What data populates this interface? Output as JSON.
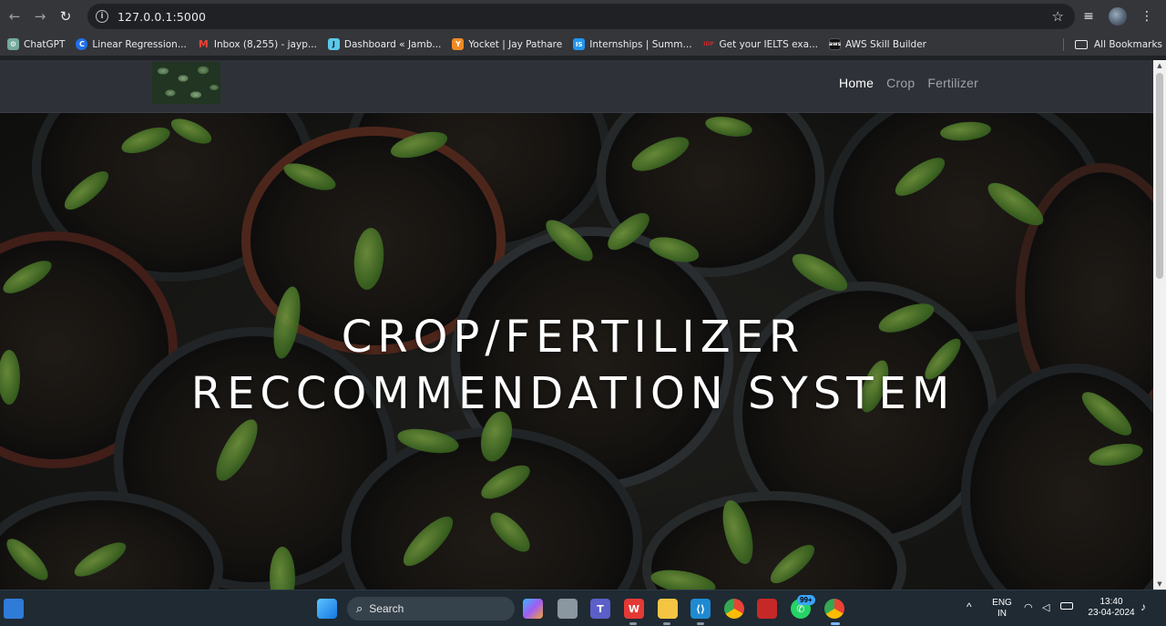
{
  "browser": {
    "url": "127.0.0.1:5000",
    "bookmarks": [
      {
        "label": "ChatGPT",
        "icon": "chatgpt-icon",
        "color": "#74aa9c",
        "glyph": "⚙"
      },
      {
        "label": "Linear Regression...",
        "icon": "coursera-icon",
        "color": "#1f6feb",
        "glyph": "C"
      },
      {
        "label": "Inbox (8,255) - jayp...",
        "icon": "gmail-icon",
        "color": "#ea4335",
        "glyph": "M"
      },
      {
        "label": "Dashboard « Jamb...",
        "icon": "jamboard-icon",
        "color": "#5cc8ea",
        "glyph": "J"
      },
      {
        "label": "Yocket | Jay Pathare",
        "icon": "yocket-icon",
        "color": "#f08a24",
        "glyph": "Y"
      },
      {
        "label": "Internships | Summ...",
        "icon": "internshala-icon",
        "color": "#2196f3",
        "glyph": "IS"
      },
      {
        "label": "Get your IELTS exa...",
        "icon": "ielts-icon",
        "color": "#c62828",
        "glyph": "·"
      },
      {
        "label": "AWS Skill Builder",
        "icon": "aws-icon",
        "color": "#111111",
        "glyph": "a"
      }
    ],
    "all_bookmarks": "All Bookmarks"
  },
  "site": {
    "nav": [
      {
        "label": "Home",
        "active": true
      },
      {
        "label": "Crop",
        "active": false
      },
      {
        "label": "Fertilizer",
        "active": false
      }
    ],
    "hero_title_line1": "CROP/FERTILIZER",
    "hero_title_line2": "RECCOMMENDATION SYSTEM"
  },
  "taskbar": {
    "search_label": "Search",
    "whatsapp_badge": "99+",
    "language_line1": "ENG",
    "language_line2": "IN",
    "time": "13:40",
    "date": "23-04-2024"
  }
}
